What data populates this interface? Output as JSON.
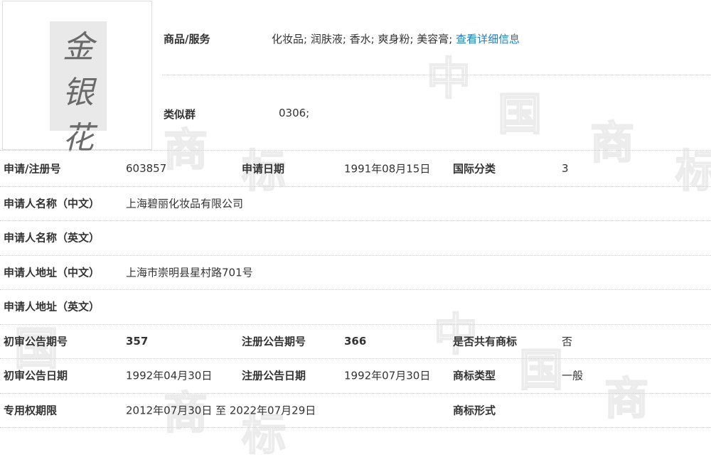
{
  "watermark": "中国商标",
  "logo": {
    "text": [
      "金",
      "银",
      "花"
    ]
  },
  "goods": {
    "label": "商品/服务",
    "value": "化妆品; 润肤液; 香水; 爽身粉; 美容膏;",
    "link": "查看详细信息"
  },
  "similar_group": {
    "label": "类似群",
    "value": "0306;"
  },
  "rows": [
    [
      {
        "t": "申请/注册号",
        "b": true
      },
      {
        "t": "603857"
      },
      {
        "t": "申请日期",
        "b": true
      },
      {
        "t": "1991年08月15日"
      },
      {
        "t": "国际分类",
        "b": true
      },
      {
        "t": "3"
      }
    ],
    [
      {
        "t": "申请人名称（中文）",
        "b": true
      },
      {
        "t": "上海碧丽化妆品有限公司"
      }
    ],
    [
      {
        "t": "申请人名称（英文）",
        "b": true
      }
    ],
    [
      {
        "t": "申请人地址（中文）",
        "b": true
      },
      {
        "t": "上海市崇明县星村路701号"
      }
    ],
    [
      {
        "t": "申请人地址（英文）",
        "b": true
      }
    ],
    [
      {
        "t": "初审公告期号",
        "b": true
      },
      {
        "t": "357",
        "b": true
      },
      {
        "t": "注册公告期号",
        "b": true
      },
      {
        "t": "366",
        "b": true
      },
      {
        "t": "是否共有商标",
        "b": true
      },
      {
        "t": "否"
      }
    ],
    [
      {
        "t": "初审公告日期",
        "b": true
      },
      {
        "t": "1992年04月30日"
      },
      {
        "t": "注册公告日期",
        "b": true
      },
      {
        "t": "1992年07月30日"
      },
      {
        "t": "商标类型",
        "b": true
      },
      {
        "t": "一般"
      }
    ],
    [
      {
        "t": "专用权期限",
        "b": true
      },
      {
        "t": "2012年07月30日 至 2022年07月29日"
      },
      null,
      null,
      {
        "t": "商标形式",
        "b": true
      }
    ]
  ]
}
